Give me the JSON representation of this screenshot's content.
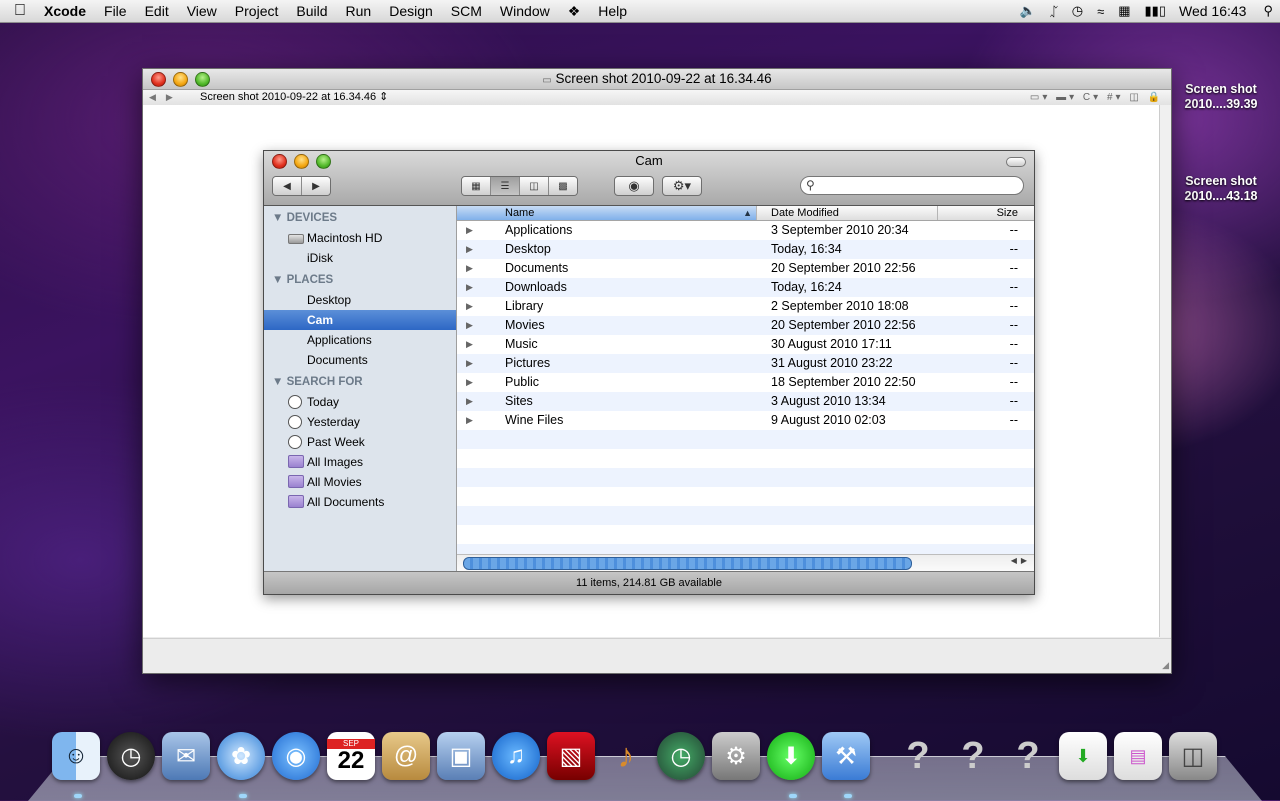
{
  "menubar": {
    "app": "Xcode",
    "items": [
      "File",
      "Edit",
      "View",
      "Project",
      "Build",
      "Run",
      "Design",
      "SCM",
      "Window",
      "Help"
    ],
    "clock": "Wed 16:43"
  },
  "desktop_icons": [
    {
      "label": "Screen shot 2010....39.39"
    },
    {
      "label": "Screen shot 2010....43.18"
    }
  ],
  "preview": {
    "title": "Screen shot 2010-09-22 at 16.34.46",
    "breadcrumb": "Screen shot 2010-09-22 at 16.34.46 ⇕"
  },
  "finder": {
    "title": "Cam",
    "search_placeholder": "",
    "sidebar": {
      "devices_header": "DEVICES",
      "devices": [
        "Macintosh HD",
        "iDisk"
      ],
      "places_header": "PLACES",
      "places": [
        "Desktop",
        "Cam",
        "Applications",
        "Documents"
      ],
      "selected": "Cam",
      "search_header": "SEARCH FOR",
      "searches": [
        "Today",
        "Yesterday",
        "Past Week",
        "All Images",
        "All Movies",
        "All Documents"
      ]
    },
    "columns": {
      "name": "Name",
      "date": "Date Modified",
      "size": "Size"
    },
    "rows": [
      {
        "name": "Applications",
        "date": "3 September 2010 20:34",
        "size": "--"
      },
      {
        "name": "Desktop",
        "date": "Today, 16:34",
        "size": "--"
      },
      {
        "name": "Documents",
        "date": "20 September 2010 22:56",
        "size": "--"
      },
      {
        "name": "Downloads",
        "date": "Today, 16:24",
        "size": "--"
      },
      {
        "name": "Library",
        "date": "2 September 2010 18:08",
        "size": "--"
      },
      {
        "name": "Movies",
        "date": "20 September 2010 22:56",
        "size": "--"
      },
      {
        "name": "Music",
        "date": "30 August 2010 17:11",
        "size": "--"
      },
      {
        "name": "Pictures",
        "date": "31 August 2010 23:22",
        "size": "--"
      },
      {
        "name": "Public",
        "date": "18 September 2010 22:50",
        "size": "--"
      },
      {
        "name": "Sites",
        "date": "3 August 2010 13:34",
        "size": "--"
      },
      {
        "name": "Wine Files",
        "date": "9 August 2010 02:03",
        "size": "--"
      }
    ],
    "status": "11 items, 214.81 GB available"
  },
  "dock": {
    "calendar_month": "SEP",
    "calendar_day": "22",
    "apps": [
      "finder",
      "dashboard",
      "mail",
      "safari",
      "ichat",
      "ical",
      "address-book",
      "iphoto",
      "itunes",
      "photo-booth",
      "garageband",
      "time-machine",
      "system-preferences",
      "transmission",
      "xcode",
      "unknown-app",
      "unknown-app",
      "unknown-app",
      "downloads-stack",
      "documents-stack",
      "trash"
    ]
  },
  "colors": {
    "selection": "#2d67c5",
    "sidebar_bg": "#dde4ec",
    "row_alt": "#edf3fe"
  }
}
